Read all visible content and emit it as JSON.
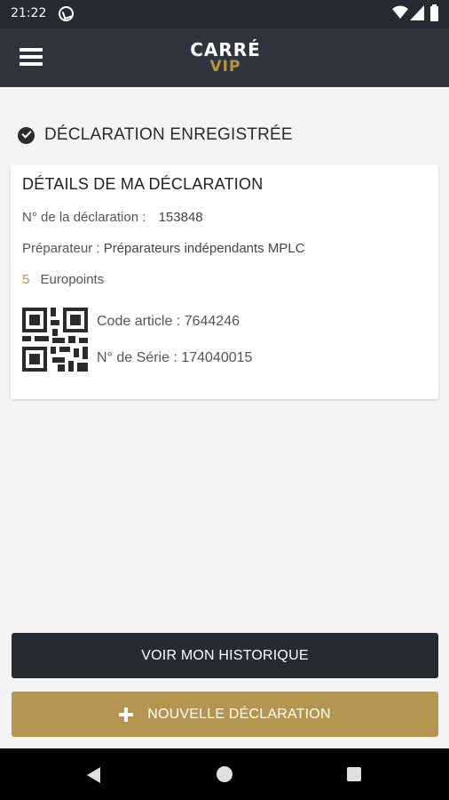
{
  "status_bar": {
    "time": "21:22",
    "icons": [
      "nfc-icon",
      "wifi-icon",
      "signal-icon",
      "battery-icon"
    ]
  },
  "app_bar": {
    "logo_line1": "CARRÉ",
    "logo_line2": "VIP"
  },
  "confirmation": {
    "text": "DÉCLARATION ENREGISTRÉE"
  },
  "card": {
    "title": "DÉTAILS DE MA DÉCLARATION",
    "declaration_label": "N° de la déclaration :",
    "declaration_value": "153848",
    "preparer_label": "Préparateur :",
    "preparer_value": "Préparateurs indépendants MPLC",
    "points_value": "5",
    "points_label": "Europoints",
    "article_code": "Code article : 7644246",
    "serial_number": "N° de Série : 174040015"
  },
  "buttons": {
    "history_label": "VOIR MON HISTORIQUE",
    "new_label": "NOUVELLE DÉCLARATION"
  },
  "colors": {
    "app_bar": "#2f343e",
    "accent_gold": "#b59650",
    "dark_button": "#262a33"
  }
}
